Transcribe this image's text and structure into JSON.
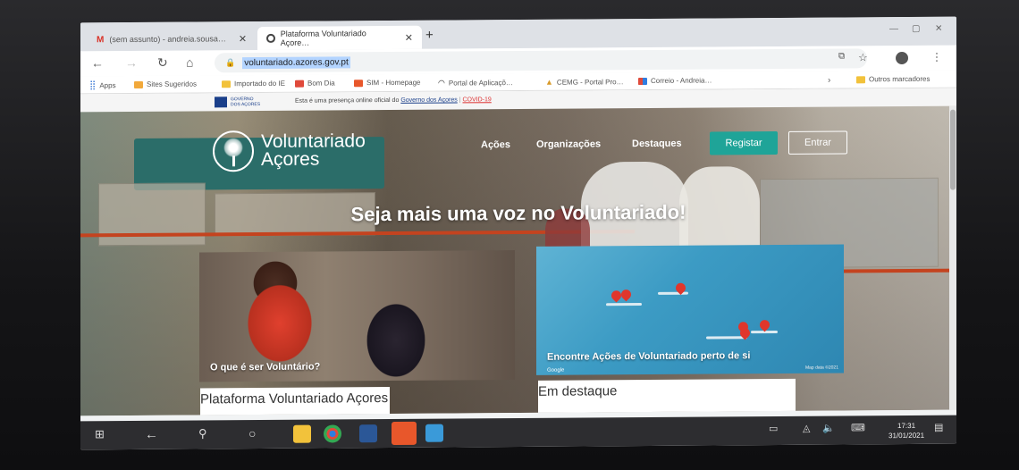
{
  "tabs": [
    {
      "title": "(sem assunto) - andreia.sousa…",
      "icon": "gmail-icon"
    },
    {
      "title": "Plataforma Voluntariado Açore…",
      "icon": "globe-icon"
    }
  ],
  "address": {
    "url": "voluntariado.azores.gov.pt"
  },
  "bookmarks": {
    "apps": "Apps",
    "items": [
      "Sites Sugeridos",
      "Importado do IE",
      "Bom Dia",
      "SIM - Homepage",
      "Portal de Aplicaçõ…",
      "CEMG - Portal Pro…",
      "Correio - Andreia…"
    ],
    "other": "Outros marcadores"
  },
  "gov": {
    "logo_text": "GOVERNO DOS AÇORES",
    "notice": "Esta é uma presença online oficial do",
    "link": "Governo dos Açores",
    "covid": "COVID-19"
  },
  "site": {
    "logo_line1": "Voluntariado",
    "logo_line2": "Açores",
    "menu": [
      "Ações",
      "Organizações",
      "Destaques"
    ],
    "register": "Registar",
    "login": "Entrar",
    "tagline": "Seja mais uma voz no Voluntariado!",
    "card1_label": "O que é ser Voluntário?",
    "card2_label": "Encontre Ações de Voluntariado perto de si",
    "map_credit": "Map data ©2021",
    "google": "Google",
    "section1": "Plataforma Voluntariado Açores",
    "section2": "Em destaque"
  },
  "taskbar": {
    "time": "17:31",
    "date": "31/01/2021"
  },
  "colors": {
    "accent": "#1fa498",
    "banner": "#2b6d69",
    "pin": "#e0362c"
  }
}
